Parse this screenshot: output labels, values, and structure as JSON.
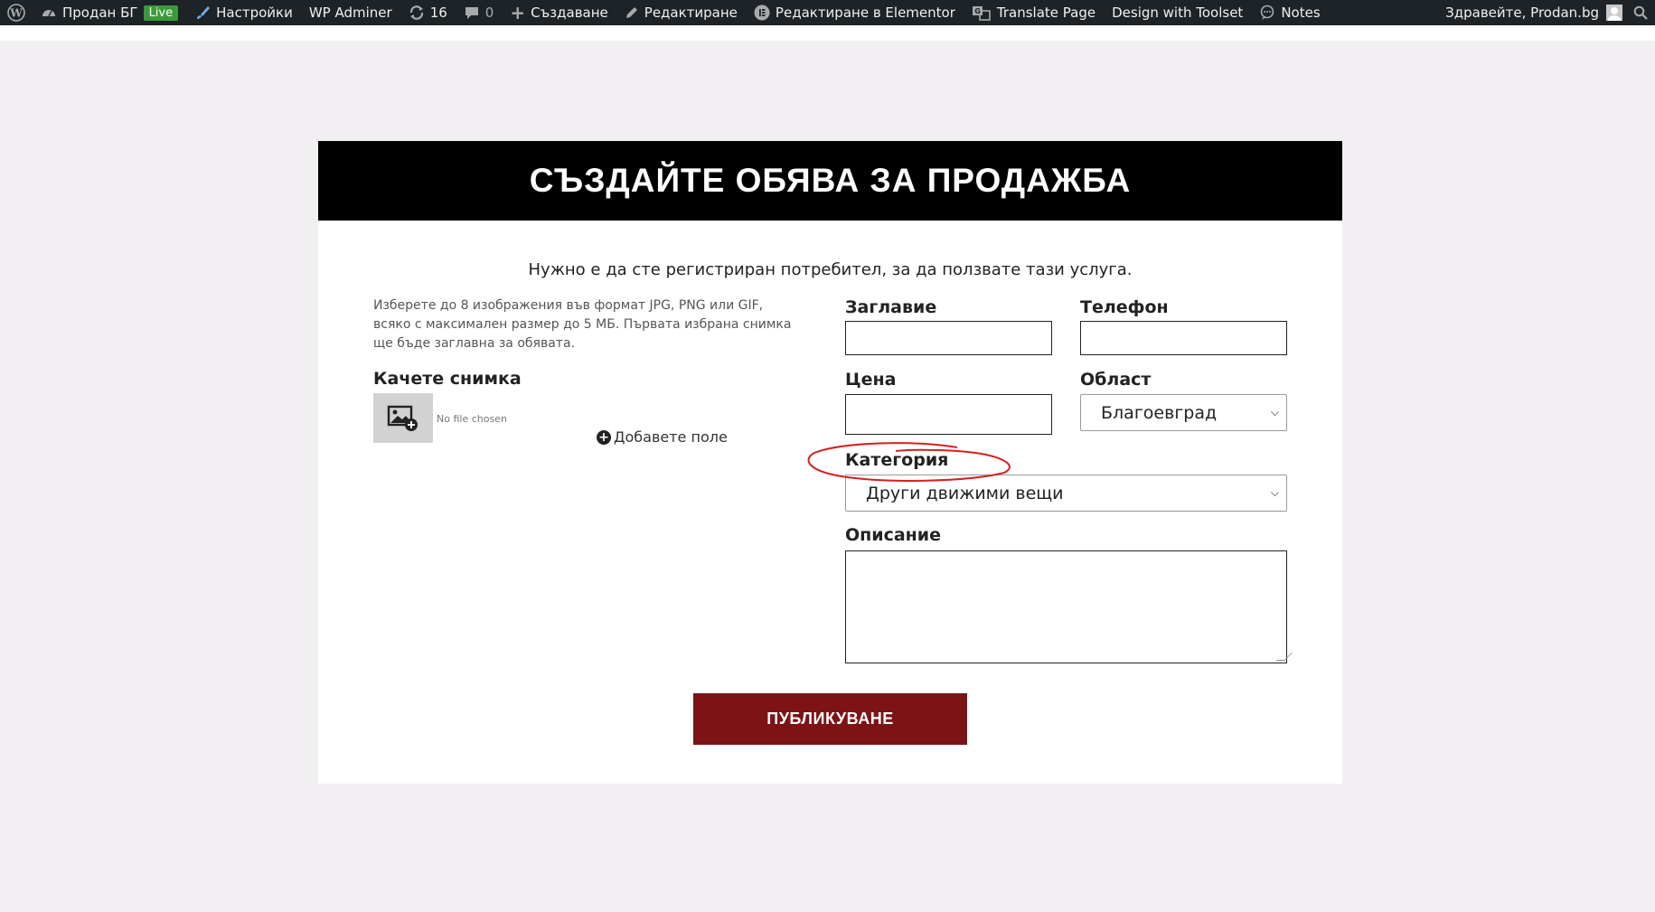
{
  "admin_bar": {
    "site_name": "Продан БГ",
    "live_badge": "Live",
    "settings": "Настройки",
    "wp_adminer": "WP Adminer",
    "updates_count": "16",
    "comments_count": "0",
    "create": "Създаване",
    "edit": "Редактиране",
    "edit_elementor": "Редактиране в Elementor",
    "translate_page": "Translate Page",
    "design_toolset": "Design with Toolset",
    "notes": "Notes",
    "greeting": "Здравейте, Prodan.bg"
  },
  "form": {
    "title": "СЪЗДАЙТЕ ОБЯВА ЗА ПРОДАЖБА",
    "notice": "Нужно е да сте регистриран потребител, за да ползвате тази услуга.",
    "upload_help": "Изберете до 8 изображения във формат JPG, PNG или GIF, всяко с максимален размер до 5 МБ. Първата избрана снимка ще бъде заглавна за обявата.",
    "upload_label": "Качете снимка",
    "no_file": "No file chosen",
    "add_field": "Добавете поле",
    "title_label": "Заглавие",
    "phone_label": "Телефон",
    "price_label": "Цена",
    "region_label": "Област",
    "region_value": "Благоевград",
    "category_label": "Категория",
    "category_value": "Други движими вещи",
    "description_label": "Описание",
    "publish_button": "ПУБЛИКУВАНЕ"
  },
  "colors": {
    "admin_bar_bg": "#1d2327",
    "header_bg": "#000000",
    "publish_bg": "#7c1315",
    "annotation": "#d42020",
    "page_bg": "#f1eff2"
  }
}
